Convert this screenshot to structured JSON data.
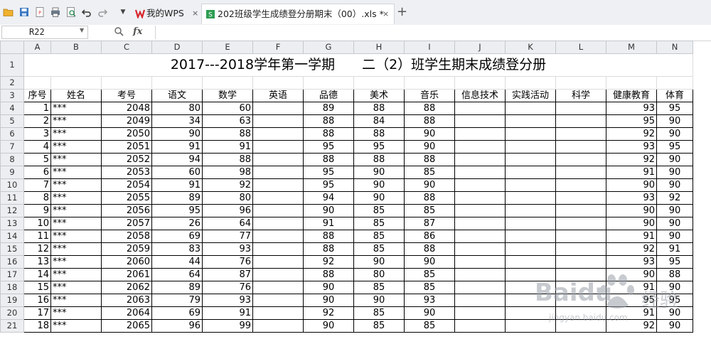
{
  "toolbar": {
    "icons": [
      "folder-open-icon",
      "save-icon",
      "export-pdf-icon",
      "print-icon",
      "print-preview-icon",
      "undo-icon",
      "redo-icon",
      "dropdown-icon"
    ],
    "tabs": [
      {
        "label": "我的WPS",
        "close": "×"
      },
      {
        "label": "202班级学生成绩登分册期末（00）.xls *",
        "close": "×"
      }
    ],
    "new_tab": "+"
  },
  "formula_bar": {
    "cell_ref": "R22",
    "fx": "fx",
    "value": ""
  },
  "columns": [
    "A",
    "B",
    "C",
    "D",
    "E",
    "F",
    "G",
    "H",
    "I",
    "J",
    "K",
    "L",
    "M",
    "N"
  ],
  "title": "2017---2018学年第一学期　　二（2）班学生期末成绩登分册",
  "headers": [
    "序号",
    "姓名",
    "考号",
    "语文",
    "数学",
    "英语",
    "品德",
    "美术",
    "音乐",
    "信息技术",
    "实践活动",
    "科学",
    "健康教育",
    "体育"
  ],
  "rows": [
    [
      1,
      "***",
      2048,
      80,
      60,
      "",
      89,
      88,
      88,
      "",
      "",
      "",
      93,
      95
    ],
    [
      2,
      "***",
      2049,
      34,
      63,
      "",
      88,
      84,
      88,
      "",
      "",
      "",
      95,
      90
    ],
    [
      3,
      "***",
      2050,
      90,
      88,
      "",
      88,
      88,
      90,
      "",
      "",
      "",
      92,
      90
    ],
    [
      4,
      "***",
      2051,
      91,
      91,
      "",
      95,
      95,
      90,
      "",
      "",
      "",
      93,
      95
    ],
    [
      5,
      "***",
      2052,
      94,
      88,
      "",
      88,
      88,
      88,
      "",
      "",
      "",
      92,
      90
    ],
    [
      6,
      "***",
      2053,
      60,
      98,
      "",
      95,
      90,
      85,
      "",
      "",
      "",
      91,
      90
    ],
    [
      7,
      "***",
      2054,
      91,
      92,
      "",
      95,
      90,
      90,
      "",
      "",
      "",
      90,
      90
    ],
    [
      8,
      "***",
      2055,
      89,
      80,
      "",
      94,
      90,
      88,
      "",
      "",
      "",
      93,
      92
    ],
    [
      9,
      "***",
      2056,
      95,
      96,
      "",
      90,
      85,
      85,
      "",
      "",
      "",
      90,
      90
    ],
    [
      10,
      "***",
      2057,
      26,
      64,
      "",
      91,
      85,
      87,
      "",
      "",
      "",
      90,
      90
    ],
    [
      11,
      "***",
      2058,
      69,
      77,
      "",
      88,
      85,
      86,
      "",
      "",
      "",
      91,
      90
    ],
    [
      12,
      "***",
      2059,
      83,
      93,
      "",
      88,
      85,
      88,
      "",
      "",
      "",
      92,
      91
    ],
    [
      13,
      "***",
      2060,
      44,
      76,
      "",
      92,
      90,
      90,
      "",
      "",
      "",
      93,
      95
    ],
    [
      14,
      "***",
      2061,
      64,
      87,
      "",
      88,
      80,
      85,
      "",
      "",
      "",
      90,
      88
    ],
    [
      15,
      "***",
      2062,
      89,
      76,
      "",
      90,
      85,
      85,
      "",
      "",
      "",
      91,
      90
    ],
    [
      16,
      "***",
      2063,
      79,
      93,
      "",
      90,
      90,
      93,
      "",
      "",
      "",
      95,
      95
    ],
    [
      17,
      "***",
      2064,
      69,
      91,
      "",
      92,
      85,
      90,
      "",
      "",
      "",
      91,
      90
    ],
    [
      18,
      "***",
      2065,
      96,
      99,
      "",
      90,
      85,
      85,
      "",
      "",
      "",
      92,
      90
    ]
  ],
  "watermark": {
    "brand": "Baidu",
    "label": "经验",
    "url": "jingyan.baidu.com"
  },
  "colors": {
    "toolbar_bg": "#eef0f3",
    "header_bg": "#eceef1",
    "wps_red": "#d8262d",
    "watermark": "#9aa0a8"
  }
}
